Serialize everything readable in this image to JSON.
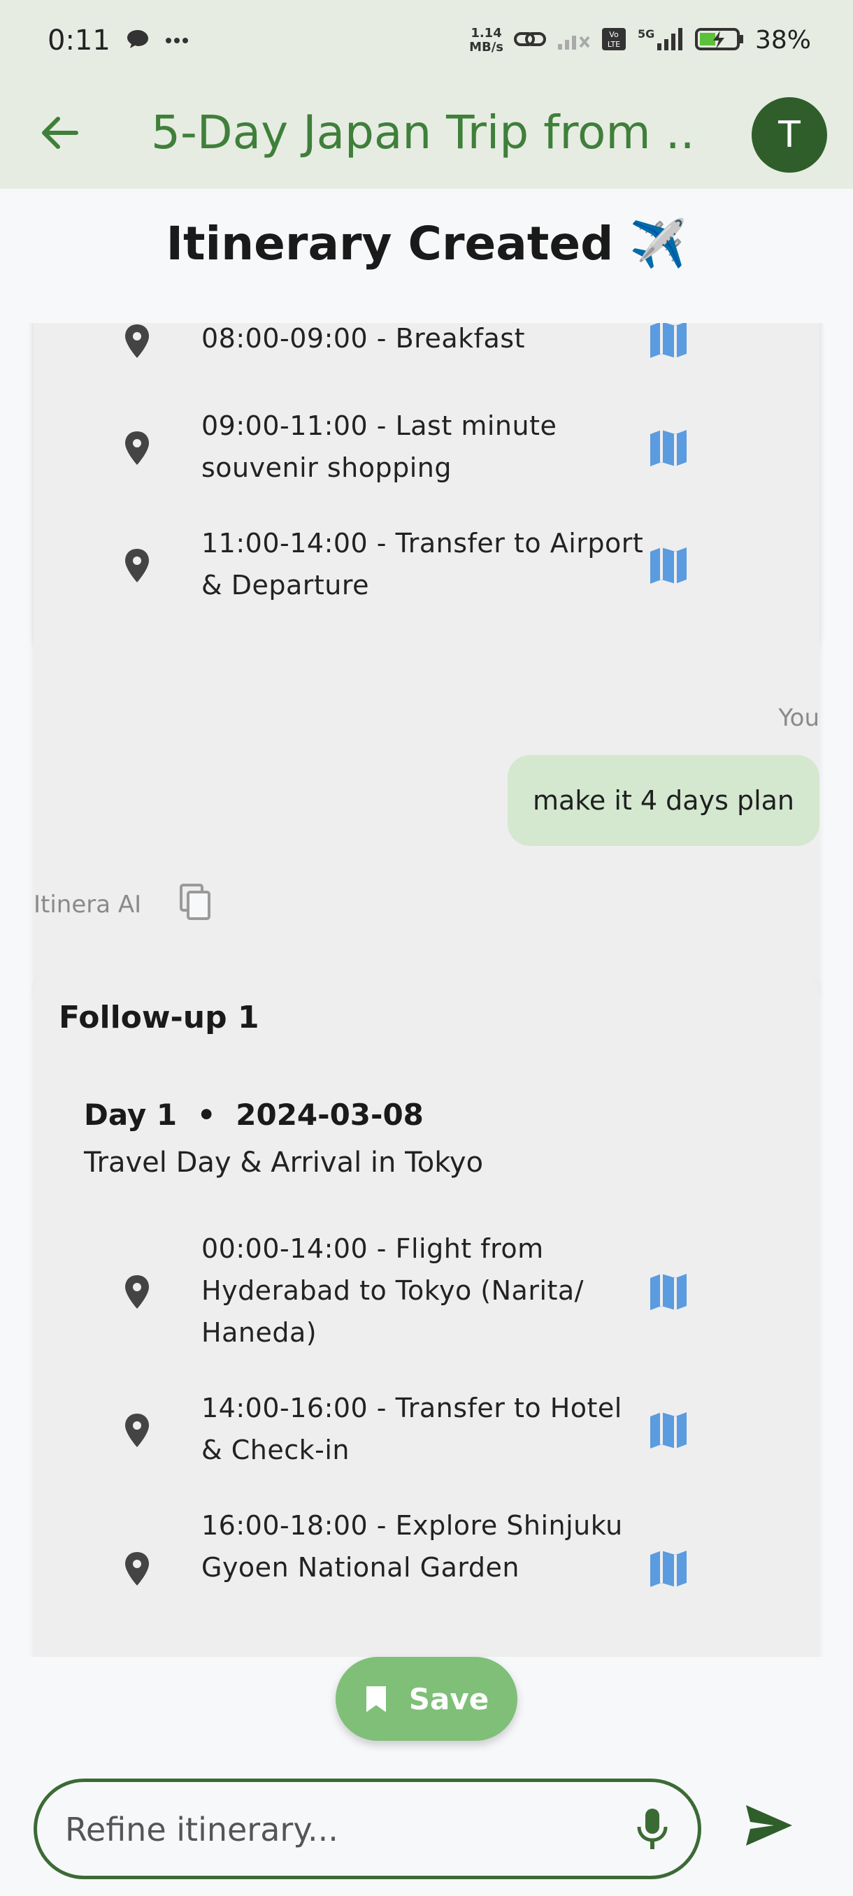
{
  "status_bar": {
    "time": "0:11",
    "speed_value": "1.14",
    "speed_unit": "MB/s",
    "network": "5G",
    "volte": "Vo LTE",
    "battery": "38%"
  },
  "app_bar": {
    "title": "5-Day Japan Trip from ...",
    "avatar_letter": "T"
  },
  "heading": "Itinerary Created ✈️",
  "card1": {
    "activities": [
      {
        "text": "08:00-09:00 - Breakfast"
      },
      {
        "text": "09:00-11:00 - Last minute souvenir shopping"
      },
      {
        "text": "11:00-14:00 - Transfer to Airport & Departure"
      }
    ]
  },
  "user_message": {
    "label": "You",
    "text": "make it 4 days plan"
  },
  "ai": {
    "label": "Itinera AI"
  },
  "card2": {
    "title": "Follow-up 1",
    "day_label": "Day 1",
    "separator": "•",
    "date": "2024-03-08",
    "subtitle": "Travel Day & Arrival in Tokyo",
    "activities": [
      {
        "text": "00:00-14:00 - Flight from Hyderabad to Tokyo (Narita/ Haneda)"
      },
      {
        "text": "14:00-16:00 - Transfer to Hotel & Check-in"
      },
      {
        "text": "16:00-18:00 - Explore Shinjuku Gyoen National Garden"
      }
    ]
  },
  "save_button": {
    "label": "Save"
  },
  "input": {
    "placeholder": "Refine itinerary...",
    "value": ""
  },
  "colors": {
    "app_bar_bg": "#e6ece2",
    "title_green": "#3f7f3a",
    "avatar_bg": "#2f5e2b",
    "card_bg": "#eeeeee",
    "user_bubble": "#d3e8cf",
    "map_icon": "#5b9be0",
    "save_bg": "#7fbf78",
    "input_border": "#3b6b35"
  },
  "icons": {
    "back": "arrow-left-icon",
    "pin": "location-pin-icon",
    "map": "map-icon",
    "copy": "copy-icon",
    "bookmark": "bookmark-icon",
    "mic": "microphone-icon",
    "send": "send-icon"
  }
}
